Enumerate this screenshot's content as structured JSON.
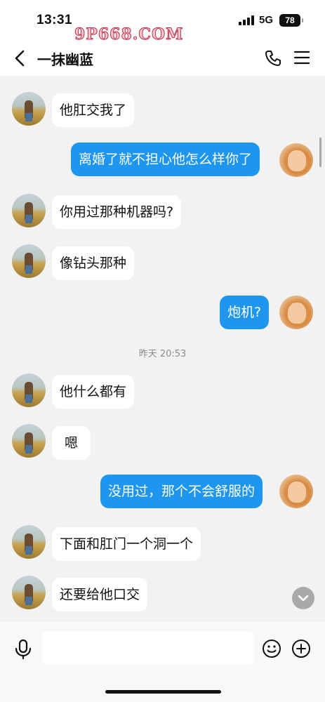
{
  "status_bar": {
    "time": "13:31",
    "network": "5G",
    "battery": "78"
  },
  "watermark": "9P668.COM",
  "header": {
    "title": "一抹幽蓝"
  },
  "messages": [
    {
      "side": "in",
      "text": "他肛交我了"
    },
    {
      "side": "out",
      "text": "离婚了就不担心他怎么样你了"
    },
    {
      "side": "in",
      "text": "你用过那种机器吗?"
    },
    {
      "side": "in",
      "text": "像钻头那种"
    },
    {
      "side": "out",
      "text": "炮机?"
    },
    {
      "side": "in",
      "text": "他什么都有"
    },
    {
      "side": "in",
      "text": "嗯"
    },
    {
      "side": "out",
      "text": "没用过，那个不会舒服的"
    },
    {
      "side": "in",
      "text": "下面和肛门一个洞一个"
    },
    {
      "side": "in",
      "text": "还要给他口交"
    }
  ],
  "timestamp": "昨天 20:53",
  "input": {
    "placeholder": ""
  },
  "colors": {
    "outgoing_bubble": "#1e96f0",
    "incoming_bubble": "#ffffff",
    "background": "#f2f2f2"
  }
}
